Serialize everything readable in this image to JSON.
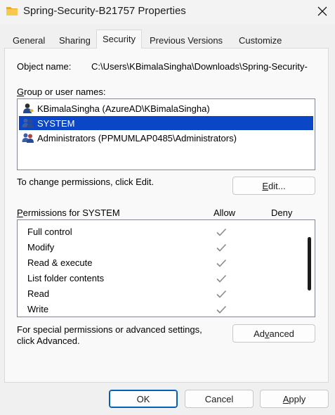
{
  "window": {
    "title": "Spring-Security-B21757 Properties"
  },
  "tabs": [
    {
      "label": "General"
    },
    {
      "label": "Sharing"
    },
    {
      "label": "Security",
      "active": true
    },
    {
      "label": "Previous Versions"
    },
    {
      "label": "Customize"
    }
  ],
  "security": {
    "object_name_label": "Object name:",
    "object_name_value": "C:\\Users\\KBimalaSingha\\Downloads\\Spring-Security-",
    "group_label_prefix": "G",
    "group_label_rest": "roup or user names:",
    "users": [
      {
        "name": "KBimalaSingha (AzureAD\\KBimalaSingha)",
        "icon": "single-user-icon",
        "selected": false
      },
      {
        "name": "SYSTEM",
        "icon": "user-group-icon",
        "selected": true
      },
      {
        "name": "Administrators (PPMUMLAP0485\\Administrators)",
        "icon": "user-group-icon",
        "selected": false
      }
    ],
    "change_hint": "To change permissions, click Edit.",
    "edit_button_prefix": "E",
    "edit_button_rest": "dit...",
    "permissions_label_prefix": "P",
    "permissions_label_rest": "ermissions for SYSTEM",
    "allow_header": "Allow",
    "deny_header": "Deny",
    "permissions": [
      {
        "name": "Full control",
        "allow": true,
        "deny": false
      },
      {
        "name": "Modify",
        "allow": true,
        "deny": false
      },
      {
        "name": "Read & execute",
        "allow": true,
        "deny": false
      },
      {
        "name": "List folder contents",
        "allow": true,
        "deny": false
      },
      {
        "name": "Read",
        "allow": true,
        "deny": false
      },
      {
        "name": "Write",
        "allow": true,
        "deny": false
      }
    ],
    "special_line1": "For special permissions or advanced settings,",
    "special_line2": "click Advanced.",
    "advanced_button_pre": "Ad",
    "advanced_button_ul": "v",
    "advanced_button_post": "anced"
  },
  "footer": {
    "ok_label": "OK",
    "cancel_label": "Cancel",
    "apply_prefix": "A",
    "apply_rest": "pply"
  },
  "colors": {
    "selection": "#0a46c5",
    "check": "#8a8a8a",
    "folder_icon": "#f2b630"
  }
}
